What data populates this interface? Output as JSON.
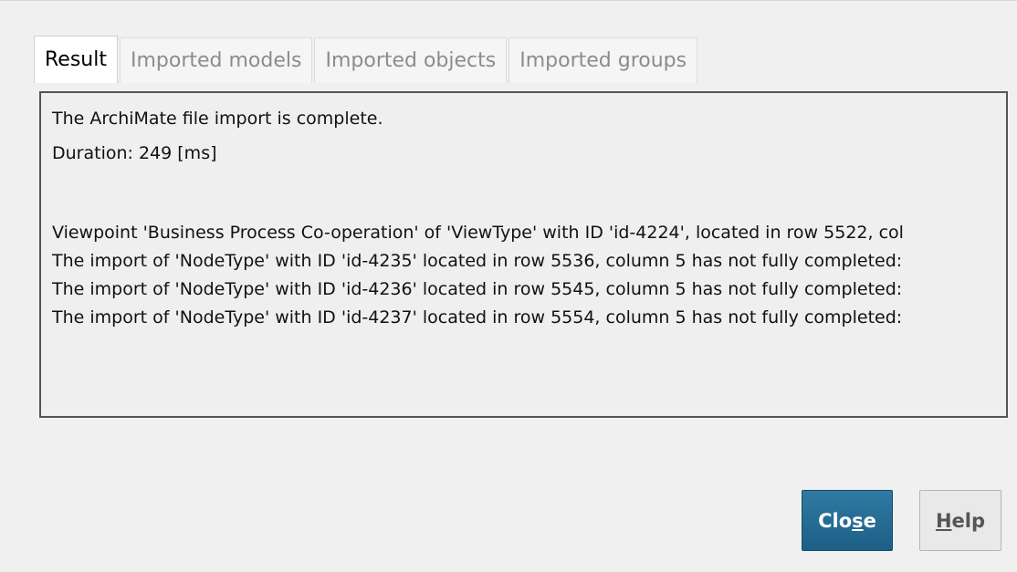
{
  "tabs": [
    {
      "label": "Result",
      "active": true
    },
    {
      "label": "Imported models",
      "active": false
    },
    {
      "label": "Imported objects",
      "active": false
    },
    {
      "label": "Imported groups",
      "active": false
    }
  ],
  "result": {
    "status": "The ArchiMate file import is complete.",
    "duration": "Duration: 249 [ms]",
    "log": [
      "Viewpoint 'Business Process Co-operation' of 'ViewType' with ID 'id-4224', located in row 5522, col",
      "The import of 'NodeType' with ID 'id-4235' located in row 5536, column 5 has not fully completed:",
      "The import of 'NodeType' with ID 'id-4236' located in row 5545, column 5 has not fully completed:",
      "The import of 'NodeType' with ID 'id-4237' located in row 5554, column 5 has not fully completed:"
    ]
  },
  "buttons": {
    "close": {
      "pre": "Clo",
      "mnemonic": "s",
      "post": "e"
    },
    "help": {
      "pre": "",
      "mnemonic": "H",
      "post": "elp"
    }
  },
  "colors": {
    "primary_button": "#1d5f85",
    "dialog_bg": "#f0f0f0"
  }
}
